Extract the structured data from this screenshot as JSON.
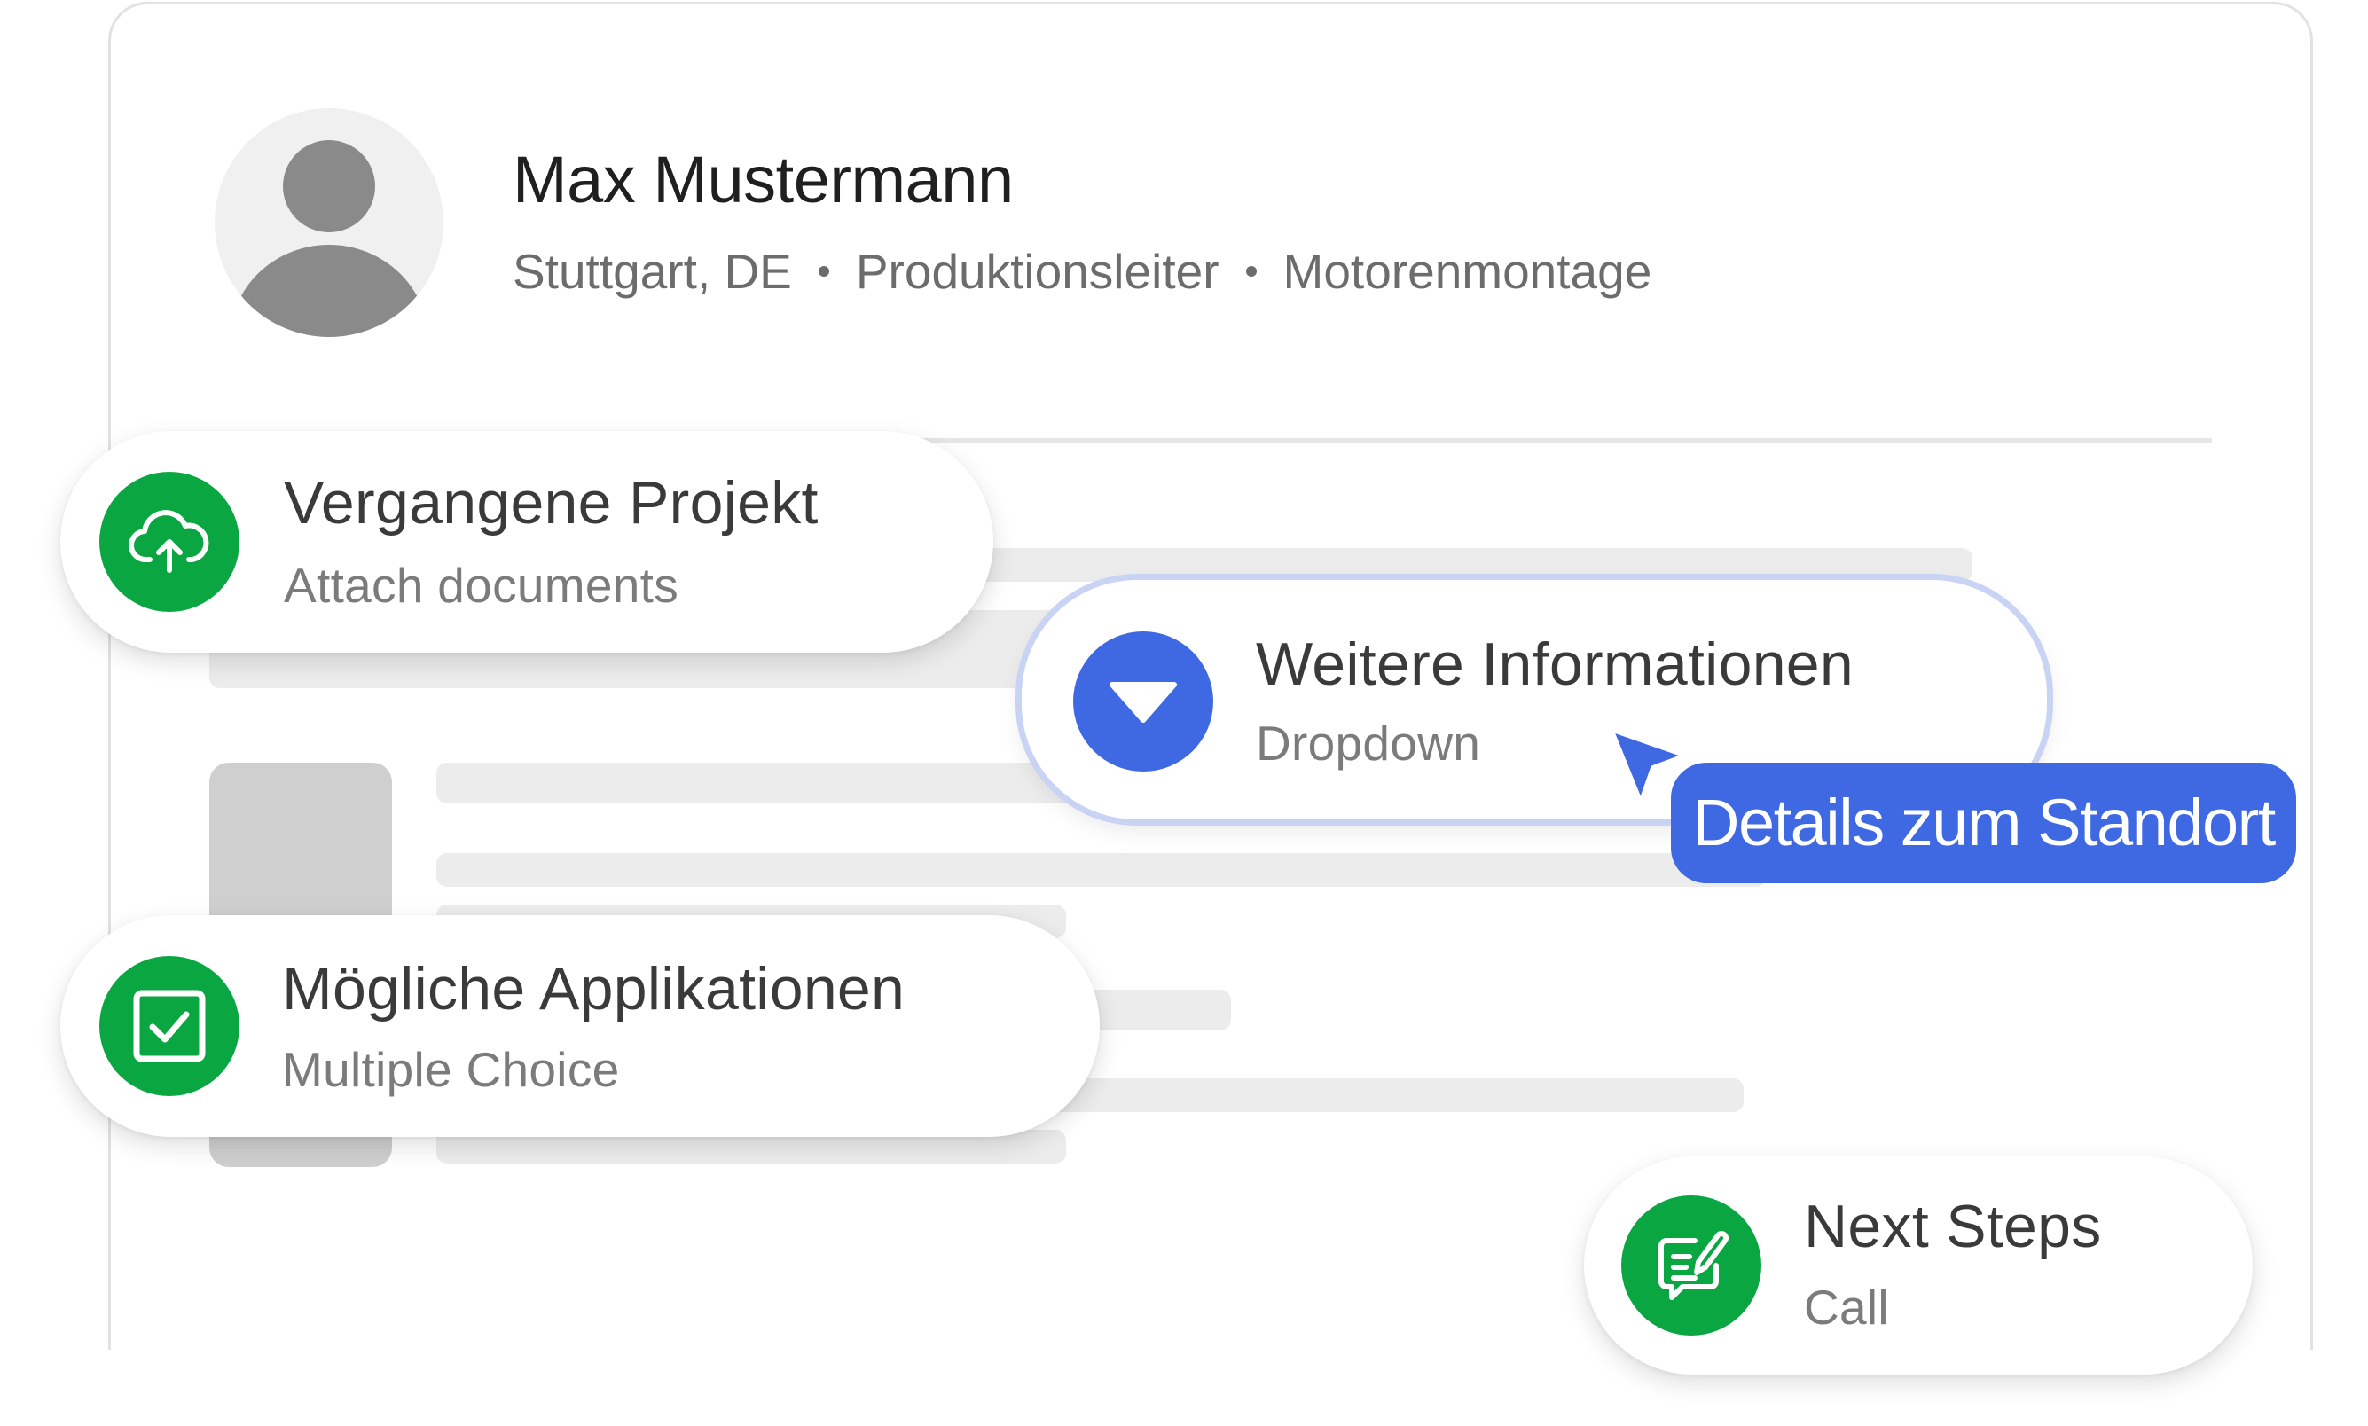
{
  "profile": {
    "name": "Max Mustermann",
    "location": "Stuttgart, DE",
    "role": "Produktionsleiter",
    "department": "Motorenmontage",
    "avatar_icon": "user-avatar-icon"
  },
  "cards": {
    "past_projects": {
      "title": "Vergangene Projekt",
      "subtitle": "Attach documents",
      "icon": "cloud-upload-icon",
      "color": "#0aa641"
    },
    "more_info": {
      "title": "Weitere Informationen",
      "subtitle": "Dropdown",
      "icon": "dropdown-triangle-icon",
      "color": "#3f68e3"
    },
    "applications": {
      "title": "Mögliche Applikationen",
      "subtitle": "Multiple Choice",
      "icon": "checkbox-icon",
      "color": "#0aa641"
    },
    "next_steps": {
      "title": "Next Steps",
      "subtitle": "Call",
      "icon": "edit-message-icon",
      "color": "#0aa641"
    }
  },
  "tooltip": {
    "label": "Details zum Standort",
    "color": "#3f68e3"
  }
}
